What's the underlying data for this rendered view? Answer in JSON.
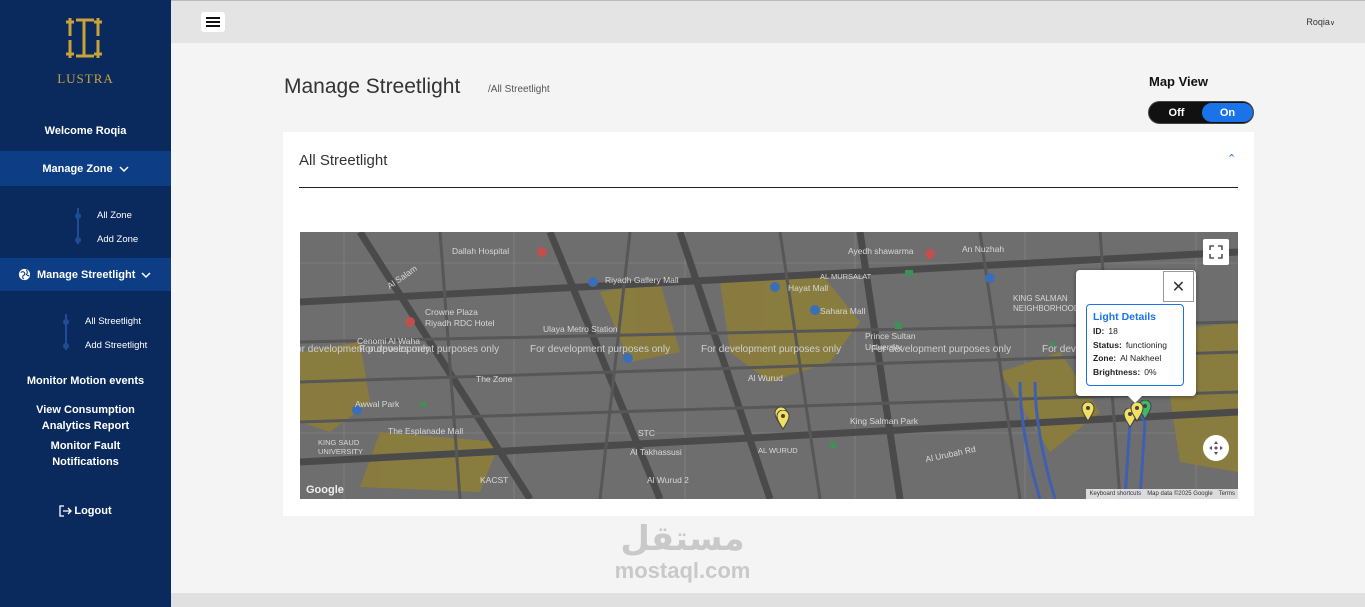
{
  "sidebar": {
    "logo_text": "LUSTRA",
    "welcome": "Welcome Roqia",
    "manage_zone": "Manage Zone",
    "zone_items": [
      "All Zone",
      "Add Zone"
    ],
    "manage_streetlight": "Manage Streetlight",
    "streetlight_items": [
      "All Streetlight",
      "Add Streetlight"
    ],
    "monitor_motion": "Monitor Motion events",
    "view_consumption": "View Consumption Analytics Report",
    "monitor_fault": "Monitor Fault Notifications",
    "logout": "Logout"
  },
  "topbar": {
    "user": "Roqia"
  },
  "main": {
    "title": "Manage Streetlight",
    "breadcrumb": "/All Streetlight",
    "map_view_label": "Map View",
    "toggle_off": "Off",
    "toggle_on": "On",
    "card_title": "All Streetlight"
  },
  "map": {
    "labels": {
      "dallah": "Dallah Hospital",
      "riyadh_gallery": "Riyadh Gallery Mall",
      "ayedh": "Ayedh shawarma",
      "an_nuzhah": "An Nuzhah",
      "al_mursalat": "AL MURSALAT",
      "hayat": "Hayat Mall",
      "sahara": "Sahara Mall",
      "king_salman": "KING SALMAN NEIGHBORHOOD",
      "crowne": "Crowne Plaza Riyadh RDC Hotel",
      "ulaya": "Ulaya Metro Station",
      "prince_sultan": "Prince Sultan University",
      "cenomi": "Cenomi Al Waha",
      "the_zone": "The Zone",
      "al_wurud": "Al Wurud",
      "awwal_park": "Awwal Park",
      "king_salman_park": "King Salman Park",
      "esplanade": "The Esplanade Mall",
      "stc": "STC",
      "al_takhassusi": "Al Takhassusi",
      "al_wurud_2": "AL WURUD",
      "king_saud": "KING SAUD UNIVERSITY",
      "kacst": "KACST",
      "al_wurud_2b": "Al Wurud 2",
      "al_urubah": "Al Urubah Rd",
      "salam": "Al Salam"
    },
    "dev_text": "For development purposes only",
    "attribution": [
      "Keyboard shortcuts",
      "Map data ©2025 Google",
      "Terms"
    ],
    "google": "Google"
  },
  "info_window": {
    "title": "Light Details",
    "id_label": "ID:",
    "id_value": "18",
    "status_label": "Status:",
    "status_value": "functioning",
    "zone_label": "Zone:",
    "zone_value": "Al Nakheel",
    "brightness_label": "Brightness:",
    "brightness_value": "0%"
  },
  "watermark": {
    "arabic": "مستقل",
    "latin": "mostaql.com"
  },
  "colors": {
    "sidebar": "#0a2a5e",
    "sidebar_active": "#0d3d84",
    "accent": "#1a73e8",
    "logo_gold": "#c9a23a"
  }
}
